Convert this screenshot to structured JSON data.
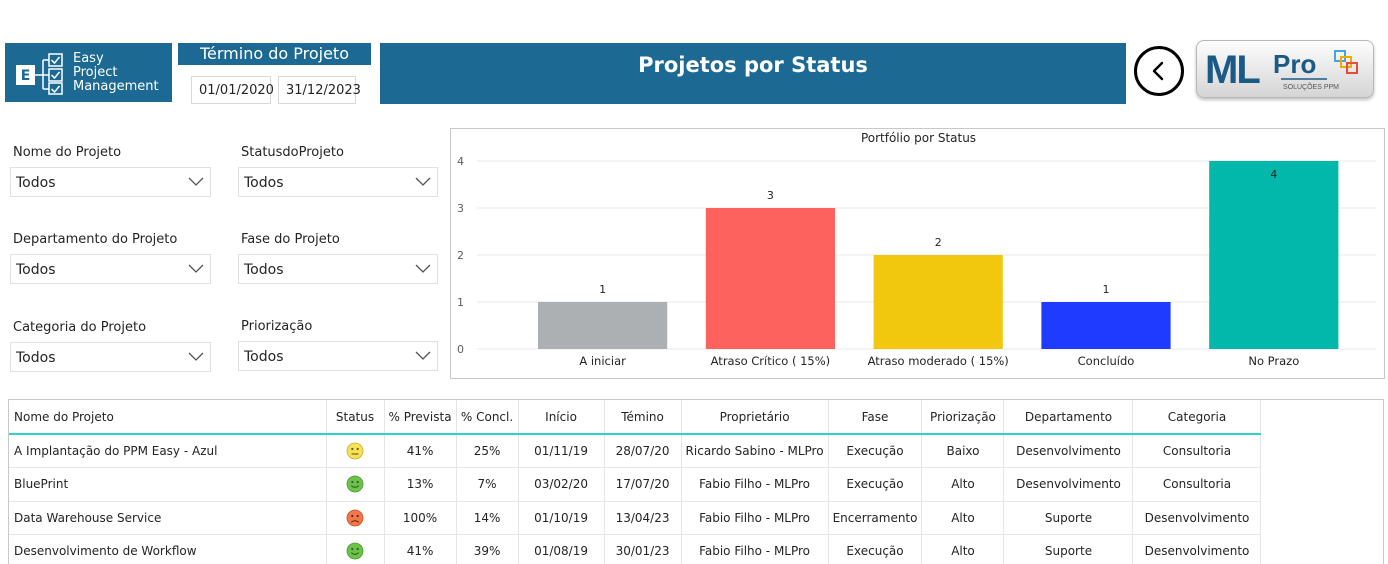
{
  "logo": {
    "line1": "Easy",
    "line2": "Project",
    "line3": "Management",
    "icon_letter": "E"
  },
  "date_filter": {
    "title": "Término do Projeto",
    "start": "01/01/2020",
    "end": "31/12/2023"
  },
  "page_title": "Projetos por Status",
  "back_button": {
    "icon": "chevron-left-icon"
  },
  "brand": {
    "name_main": "ML",
    "name_accent": "Pro",
    "tagline": "SOLUÇÕES PPM"
  },
  "filters": [
    {
      "label": "Nome do Projeto",
      "value": "Todos"
    },
    {
      "label": "StatusdoProjeto",
      "value": "Todos"
    },
    {
      "label": "Departamento do Projeto",
      "value": "Todos"
    },
    {
      "label": "Fase do Projeto",
      "value": "Todos"
    },
    {
      "label": "Categoria do Projeto",
      "value": "Todos"
    },
    {
      "label": "Priorização",
      "value": "Todos"
    }
  ],
  "chart_data": {
    "type": "bar",
    "title": "Portfólio por Status",
    "categories": [
      "A iniciar",
      "Atraso Crítico ( 15%)",
      "Atraso moderado ( 15%)",
      "Concluído",
      "No Prazo"
    ],
    "values": [
      1,
      3,
      2,
      1,
      4
    ],
    "colors": [
      "#acb0b2",
      "#fd625e",
      "#f2c80f",
      "#1e3bff",
      "#01b8aa"
    ],
    "ylim": [
      0,
      4
    ],
    "yticks": [
      "0",
      "1",
      "2",
      "3",
      "4"
    ],
    "grid": true,
    "legend": "none"
  },
  "table": {
    "columns": [
      "Nome do Projeto",
      "Status",
      "% Prevista",
      "% Concl.",
      "Início",
      "Témino",
      "Proprietário",
      "Fase",
      "Priorização",
      "Departamento",
      "Categoria"
    ],
    "rows": [
      {
        "name": "A Implantação do PPM Easy - Azul",
        "status": "neutral",
        "prevista": "41%",
        "concl": "25%",
        "inicio": "01/11/19",
        "termino": "28/07/20",
        "owner": "Ricardo Sabino - MLPro",
        "fase": "Execução",
        "prior": "Baixo",
        "dept": "Desenvolvimento",
        "cat": "Consultoria"
      },
      {
        "name": "BluePrint",
        "status": "happy",
        "prevista": "13%",
        "concl": "7%",
        "inicio": "03/02/20",
        "termino": "17/07/20",
        "owner": "Fabio Filho - MLPro",
        "fase": "Execução",
        "prior": "Alto",
        "dept": "Desenvolvimento",
        "cat": "Consultoria"
      },
      {
        "name": "Data Warehouse Service",
        "status": "sad",
        "prevista": "100%",
        "concl": "14%",
        "inicio": "01/10/19",
        "termino": "13/04/23",
        "owner": "Fabio Filho - MLPro",
        "fase": "Encerramento",
        "prior": "Alto",
        "dept": "Suporte",
        "cat": "Desenvolvimento"
      },
      {
        "name": "Desenvolvimento de Workflow",
        "status": "happy",
        "prevista": "41%",
        "concl": "39%",
        "inicio": "01/08/19",
        "termino": "30/01/23",
        "owner": "Fabio Filho - MLPro",
        "fase": "Execução",
        "prior": "Alto",
        "dept": "Suporte",
        "cat": "Desenvolvimento"
      }
    ]
  },
  "colors": {
    "header_blue": "#1c6a93",
    "table_accent": "#2dd3c6"
  }
}
